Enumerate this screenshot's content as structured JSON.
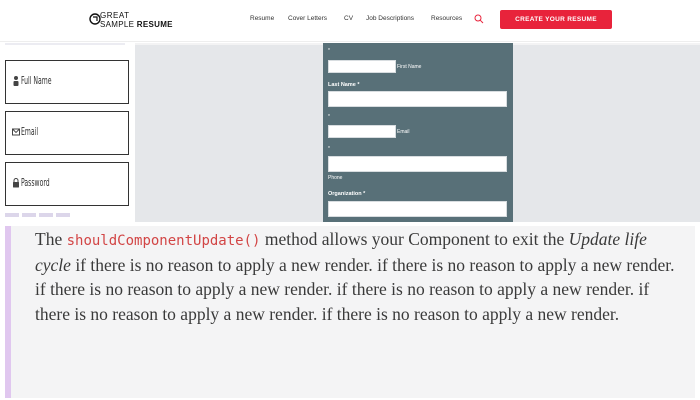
{
  "header": {
    "logo": {
      "line1": "GREAT",
      "line2_normal": "SAMPLE",
      "line2_bold": "RESUME"
    },
    "nav": [
      {
        "id": "resume",
        "label": "Resume"
      },
      {
        "id": "cover-letters",
        "label": "Cover Letters"
      },
      {
        "id": "cv",
        "label": "CV"
      },
      {
        "id": "job-descriptions",
        "label": "Job Descriptions"
      },
      {
        "id": "resources",
        "label": "Resources"
      }
    ],
    "search_icon": "search-icon",
    "cta": "CREATE YOUR RESUME"
  },
  "left_form": {
    "fields": [
      {
        "label": "Full Name",
        "icon": "user-icon"
      },
      {
        "label": "Email",
        "icon": "envelope-icon"
      },
      {
        "label": "Password",
        "icon": "lock-icon"
      }
    ]
  },
  "center_form": {
    "first_name_label": "First Name",
    "last_name_label": "Last Name *",
    "email_label": "Email",
    "phone_label": "Phone",
    "organization_label": "Organization *",
    "asterisk": "*"
  },
  "quote": {
    "prefix": "The",
    "code": "shouldComponentUpdate()",
    "middle": "method allows your Component to exit the",
    "emphasis": "Update life cycle",
    "suffix": "if there is no reason to apply a new render. if there is no reason to apply a new render. if there is no reason to apply a new render. if there is no reason to apply a new render. if there is no reason to apply a new render. if there is no reason to apply a new render."
  },
  "colors": {
    "cta": "#e8233b",
    "form_bg": "#587078",
    "code": "#d24545",
    "quote_bar": "#e0c7ef"
  }
}
